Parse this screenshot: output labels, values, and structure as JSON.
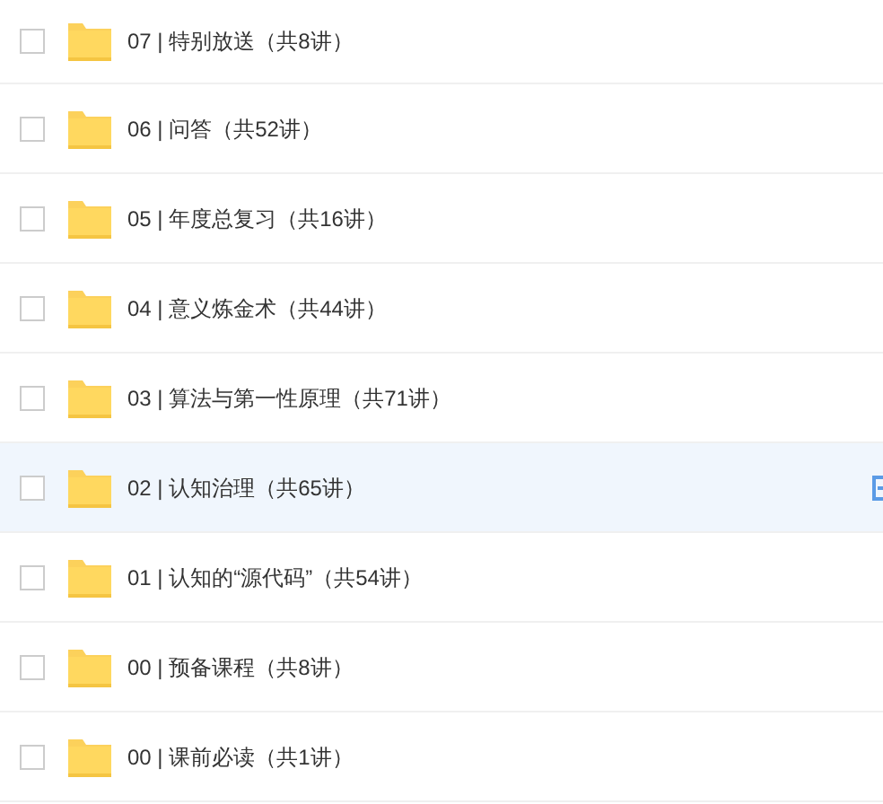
{
  "folders": [
    {
      "name": "07 | 特别放送（共8讲）",
      "checked": false,
      "selected": false
    },
    {
      "name": "06 | 问答（共52讲）",
      "checked": false,
      "selected": false
    },
    {
      "name": "05 | 年度总复习（共16讲）",
      "checked": false,
      "selected": false
    },
    {
      "name": "04 | 意义炼金术（共44讲）",
      "checked": false,
      "selected": false
    },
    {
      "name": "03 | 算法与第一性原理（共71讲）",
      "checked": false,
      "selected": false
    },
    {
      "name": "02 | 认知治理（共65讲）",
      "checked": false,
      "selected": true
    },
    {
      "name": "01 | 认知的“源代码”（共54讲）",
      "checked": false,
      "selected": false
    },
    {
      "name": "00 | 预备课程（共8讲）",
      "checked": false,
      "selected": false
    },
    {
      "name": "00 | 课前必读（共1讲）",
      "checked": false,
      "selected": false
    }
  ]
}
